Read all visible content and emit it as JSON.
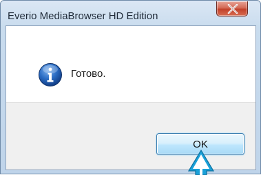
{
  "window": {
    "title": "Everio MediaBrowser HD Edition"
  },
  "dialog": {
    "message": "Готово.",
    "icon": "info-icon",
    "ok_label": "OK"
  },
  "colors": {
    "close_button": "#c2412a",
    "info_icon": "#1f5fb3",
    "ok_border": "#3c7fb1",
    "pointer": "#1aa0d8"
  }
}
